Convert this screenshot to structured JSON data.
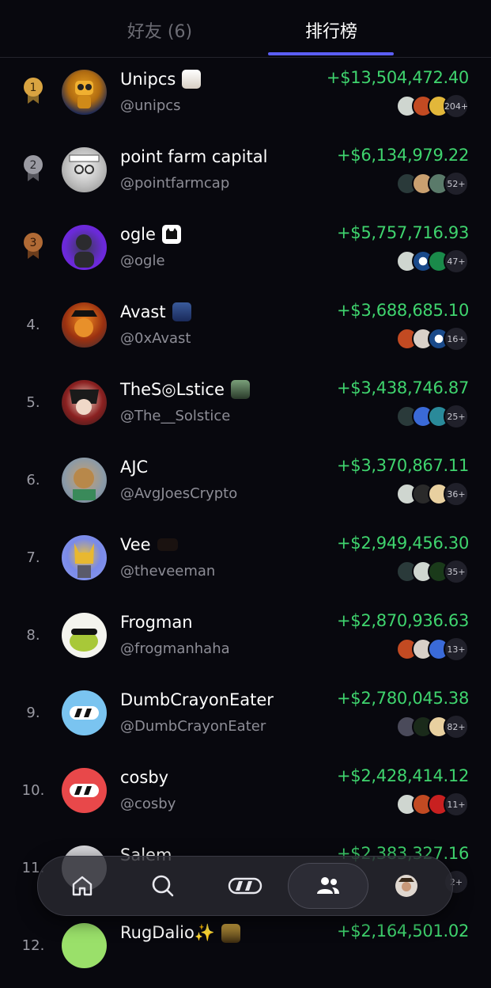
{
  "tabs": {
    "friends_label": "好友 (6)",
    "ranking_label": "排行榜"
  },
  "colors": {
    "accent": "#5b5ef5",
    "profit": "#3fd46e",
    "background": "#08080e"
  },
  "leaderboard": [
    {
      "rank": "1",
      "medal": "gold",
      "name": "Unipcs",
      "handle": "@unipcs",
      "pnl": "+$13,504,472.40",
      "token_count": "204+",
      "avatar": "robot-avatar"
    },
    {
      "rank": "2",
      "medal": "silver",
      "name": "point farm capital",
      "handle": "@pointfarmcap",
      "pnl": "+$6,134,979.22",
      "token_count": "52+",
      "avatar": "sketch-portrait-avatar"
    },
    {
      "rank": "3",
      "medal": "bronze",
      "name": "ogle",
      "handle": "@ogle",
      "pnl": "+$5,757,716.93",
      "token_count": "47+",
      "avatar": "purple-figure-avatar"
    },
    {
      "rank": "4.",
      "medal": "",
      "name": "Avast",
      "handle": "@0xAvast",
      "pnl": "+$3,688,685.10",
      "token_count": "16+",
      "avatar": "pirate-avatar"
    },
    {
      "rank": "5.",
      "medal": "",
      "name": "TheS◎Lstice",
      "handle": "@The__Solstice",
      "pnl": "+$3,438,746.87",
      "token_count": "25+",
      "avatar": "anime-avatar"
    },
    {
      "rank": "6.",
      "medal": "",
      "name": "AJC",
      "handle": "@AvgJoesCrypto",
      "pnl": "+$3,370,867.11",
      "token_count": "36+",
      "avatar": "monkey-avatar"
    },
    {
      "rank": "7.",
      "medal": "",
      "name": "Vee",
      "handle": "@theveeman",
      "pnl": "+$2,949,456.30",
      "token_count": "35+",
      "avatar": "fox-avatar"
    },
    {
      "rank": "8.",
      "medal": "",
      "name": "Frogman",
      "handle": "@frogmanhaha",
      "pnl": "+$2,870,936.63",
      "token_count": "13+",
      "avatar": "frog-avatar"
    },
    {
      "rank": "9.",
      "medal": "",
      "name": "DumbCrayonEater",
      "handle": "@DumbCrayonEater",
      "pnl": "+$2,780,045.38",
      "token_count": "82+",
      "avatar": "blue-logo-avatar"
    },
    {
      "rank": "10.",
      "medal": "",
      "name": "cosby",
      "handle": "@cosby",
      "pnl": "+$2,428,414.12",
      "token_count": "11+",
      "avatar": "red-logo-avatar"
    },
    {
      "rank": "11.",
      "medal": "",
      "name": "Salem",
      "handle": "",
      "pnl": "+$2,383,327.16",
      "token_count": "2+",
      "avatar": "partial-avatar"
    },
    {
      "rank": "12.",
      "medal": "",
      "name": "RugDalio✨",
      "handle": "",
      "pnl": "+$2,164,501.02",
      "token_count": "",
      "avatar": "partial-avatar"
    }
  ],
  "dock": {
    "items": [
      {
        "icon": "home-icon"
      },
      {
        "icon": "search-icon"
      },
      {
        "icon": "pump-logo-icon"
      },
      {
        "icon": "people-icon",
        "active": true
      },
      {
        "icon": "profile-avatar-icon"
      }
    ]
  }
}
